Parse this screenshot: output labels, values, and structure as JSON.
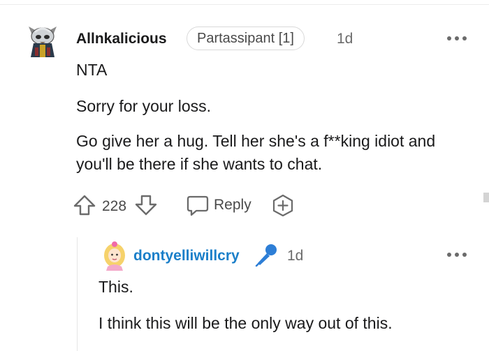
{
  "comment": {
    "username": "Allnkalicious",
    "flair": "Partassipant [1]",
    "time": "1d",
    "paragraphs": [
      "NTA",
      "Sorry for your loss.",
      "Go give her a hug. Tell her she's a f**king idiot and you'll be there if she wants to chat."
    ],
    "score": "228",
    "reply_label": "Reply"
  },
  "reply": {
    "username": "dontyelliwillcry",
    "time": "1d",
    "paragraphs": [
      "This.",
      "I think this will be the only way out of this."
    ]
  },
  "icons": {
    "upvote": "arrow-up-outline-icon",
    "downvote": "arrow-down-outline-icon",
    "reply": "speech-bubble-icon",
    "award": "plus-hexagon-icon",
    "more": "three-dots-icon",
    "flair_emoji": "microphone-icon"
  },
  "colors": {
    "reply_username": "#1b7fc9",
    "mic": "#2d7ed6"
  }
}
